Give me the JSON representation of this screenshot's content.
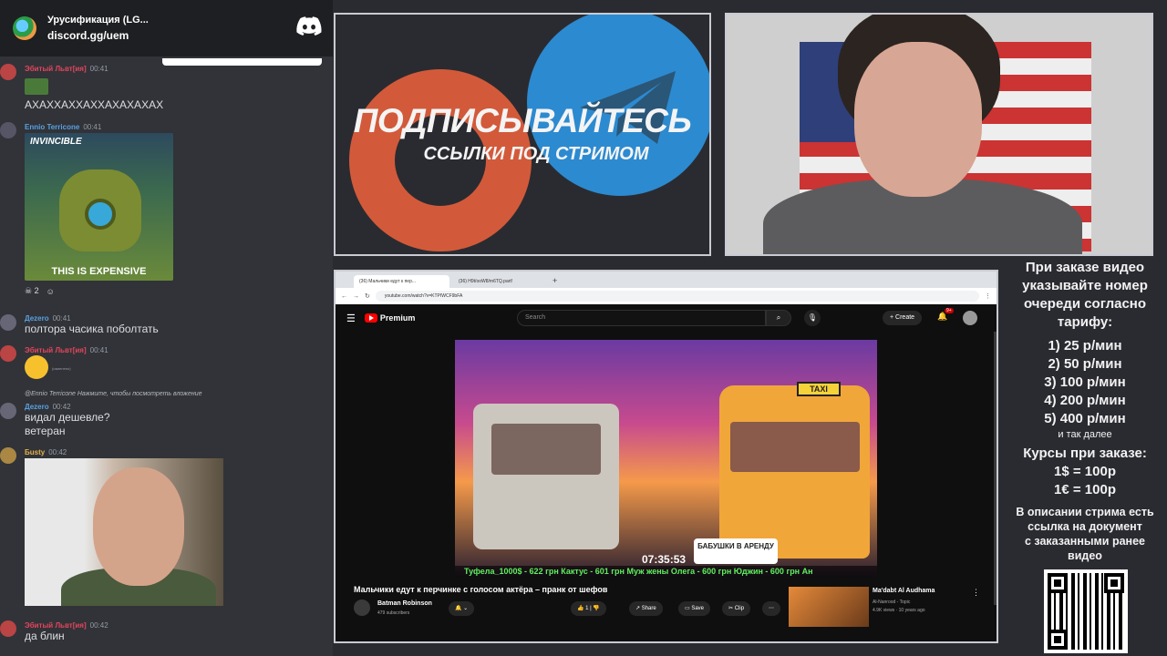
{
  "discord": {
    "server_name": "Урусификация (LG...",
    "invite": "discord.gg/uem",
    "messages": [
      {
        "user": "Эбитый Львт[ия]",
        "user_color": "#e4455d",
        "time": "00:41",
        "text": "АХАХХАХХАХХАХАХАХАХ"
      },
      {
        "user": "Ennio Terricone",
        "user_color": "#5aa0e0",
        "time": "00:41",
        "image_title": "INVINCIBLE",
        "image_caption": "THIS IS EXPENSIVE",
        "reaction_count": "2"
      },
      {
        "user": "Дezero",
        "user_color": "#5aa0e0",
        "time": "00:41",
        "text": "полтора часика поболтать"
      },
      {
        "user": "Эбитый Львт[ия]",
        "user_color": "#e4455d",
        "time": "00:41",
        "text": "(изменено)"
      },
      {
        "reply": "@Ennio Terricone  Нажмите, чтобы посмотреть вложение",
        "user": "Дezero",
        "user_color": "#5aa0e0",
        "time": "00:42",
        "text": "видал дешевле?",
        "text2": "ветеран"
      },
      {
        "user": "Бusty",
        "user_color": "#e4b04a",
        "time": "00:42"
      },
      {
        "user": "Эбитый Львт[ия]",
        "user_color": "#e4455d",
        "time": "00:42",
        "text": "да блин"
      }
    ]
  },
  "promo": {
    "title": "ПОДПИСЫВАЙТЕСЬ",
    "subtitle": "ССЫЛКИ ПОД СТРИМОМ"
  },
  "browser": {
    "tabs": [
      "(36) Мальчики едут к пер...",
      "(36) H9t/ooW8/m6TQ.part!"
    ],
    "url": "youtube.com/watch?v=KTPIWCF9bFA",
    "yt_brand": "Premium",
    "search_placeholder": "Search",
    "create_label": "Create",
    "notif_badge": "9+",
    "video": {
      "taxi": "TAXI",
      "timer": "07:35:53",
      "grandma_label": "БАБУШКИ В АРЕНДУ",
      "ticker": "Туфела_1000$ - 622 грн   Кактус - 601 грн   Муж жены Олега - 600 грн   Юджин - 600 грн   Ан"
    },
    "title": "Мальчики едут к перчинке с голосом актёра – пранк от шефов",
    "channel": "Batman Robinson",
    "subscribers": "479 subscribers",
    "likes": "1",
    "share": "Share",
    "save": "Save",
    "clip": "Clip",
    "side": {
      "title": "Ma'dabt Al Audhama",
      "channel": "Al-Nanrood - Topic",
      "meta": "4.9K views · 10 years ago"
    }
  },
  "info": {
    "intro": [
      "При заказе видео",
      "указывайте номер",
      "очереди согласно",
      "тарифу:"
    ],
    "tariffs": [
      "1) 25 р/мин",
      "2) 50 р/мин",
      "3) 100 р/мин",
      "4) 200 р/мин",
      "5) 400 р/мин"
    ],
    "more": "и так далее",
    "rates_title": "Курсы при заказе:",
    "rates": [
      "1$ = 100р",
      "1€ = 100р"
    ],
    "desc": [
      "В описании стрима есть",
      "ссылка на документ",
      "с заказанными ранее",
      "видео"
    ]
  }
}
